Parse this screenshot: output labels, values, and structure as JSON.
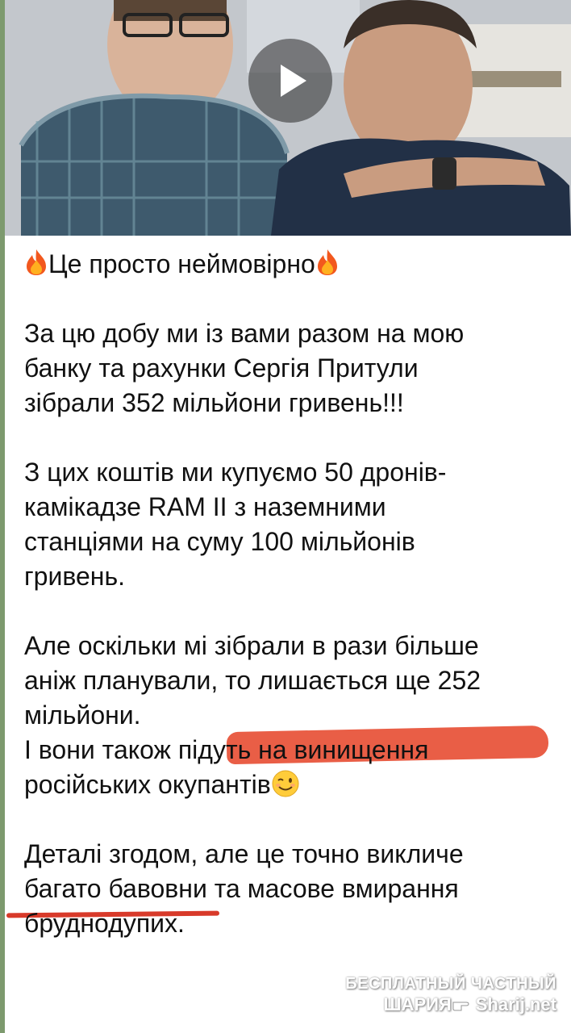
{
  "video": {
    "play_icon": "play-icon"
  },
  "message": {
    "line_1": "Це просто неймовірно",
    "para_1": [
      "За цю добу ми із вами разом на мою",
      "банку та рахунки Сергія Притули",
      "зібрали 352 мільйони гривень!!!"
    ],
    "para_2": [
      "З цих коштів ми купуємо 50 дронів-",
      "камікадзе RAM II з наземними",
      "станціями на суму 100 мільйонів",
      "гривень."
    ],
    "para_3": [
      "Але оскільки мі зібрали в рази більше",
      "аніж планували, то лишається ще 252",
      "мільйони.",
      "І вони також підуть на винищення",
      "російських окупантів"
    ],
    "para_4": [
      "Деталі згодом, але це точно викличе",
      "багато бавовни та масове вмирання",
      "бруднодупих."
    ],
    "icons": [
      "fire-icon",
      "wink-icon"
    ]
  },
  "annotations": {
    "highlight_color": "#e8553c",
    "underline_color": "#d83a2a"
  },
  "watermark": {
    "line_1": "БЕСПЛАТНЫЙ ЧАСТНЫЙ",
    "line_2_left": "ШАРИЯ",
    "line_2_right": "Sharij.net",
    "icon": "pointing-hand-icon"
  }
}
